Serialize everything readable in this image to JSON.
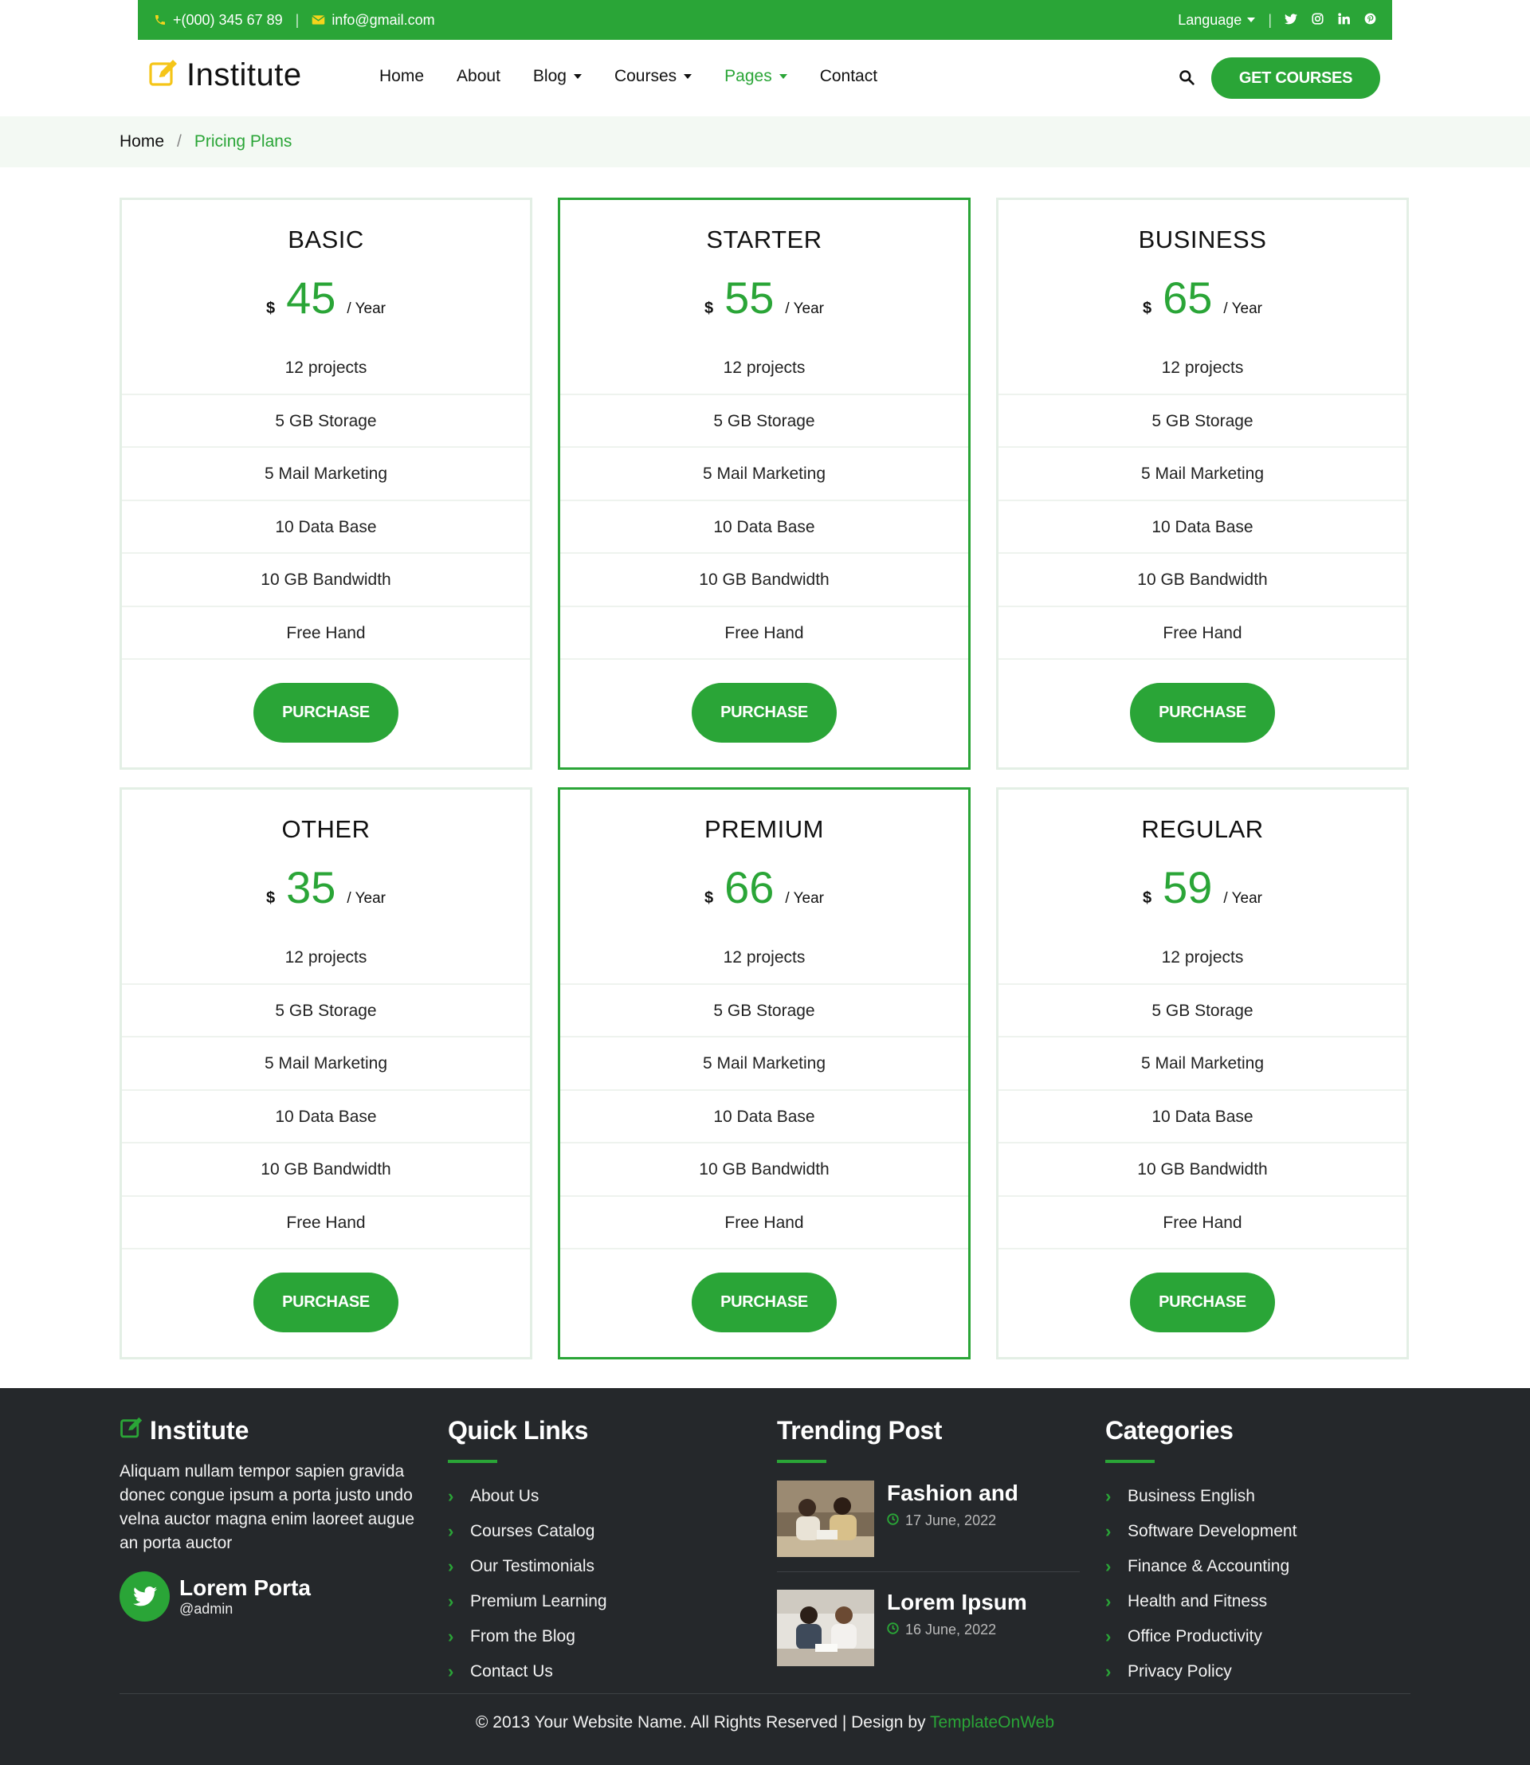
{
  "topbar": {
    "phone": "+(000) 345 67 89",
    "email": "info@gmail.com",
    "language_label": "Language",
    "socials": [
      "twitter-icon",
      "instagram-icon",
      "linkedin-icon",
      "pinterest-icon"
    ]
  },
  "header": {
    "logo_text": "Institute",
    "nav": [
      {
        "label": "Home",
        "dropdown": false,
        "active": false
      },
      {
        "label": "About",
        "dropdown": false,
        "active": false
      },
      {
        "label": "Blog",
        "dropdown": true,
        "active": false
      },
      {
        "label": "Courses",
        "dropdown": true,
        "active": false
      },
      {
        "label": "Pages",
        "dropdown": true,
        "active": true
      },
      {
        "label": "Contact",
        "dropdown": false,
        "active": false
      }
    ],
    "cta_label": "GET COURSES"
  },
  "breadcrumb": {
    "home": "Home",
    "separator": "/",
    "current": "Pricing Plans"
  },
  "pricing": {
    "plans": [
      {
        "name": "BASIC",
        "currency": "$",
        "amount": "45",
        "period": "/ Year",
        "featured": false,
        "features": [
          "12 projects",
          "5 GB Storage",
          "5 Mail Marketing",
          "10 Data Base",
          "10 GB Bandwidth",
          "Free Hand"
        ],
        "button": "PURCHASE"
      },
      {
        "name": "STARTER",
        "currency": "$",
        "amount": "55",
        "period": "/ Year",
        "featured": true,
        "features": [
          "12 projects",
          "5 GB Storage",
          "5 Mail Marketing",
          "10 Data Base",
          "10 GB Bandwidth",
          "Free Hand"
        ],
        "button": "PURCHASE"
      },
      {
        "name": "BUSINESS",
        "currency": "$",
        "amount": "65",
        "period": "/ Year",
        "featured": false,
        "features": [
          "12 projects",
          "5 GB Storage",
          "5 Mail Marketing",
          "10 Data Base",
          "10 GB Bandwidth",
          "Free Hand"
        ],
        "button": "PURCHASE"
      },
      {
        "name": "OTHER",
        "currency": "$",
        "amount": "35",
        "period": "/ Year",
        "featured": false,
        "features": [
          "12 projects",
          "5 GB Storage",
          "5 Mail Marketing",
          "10 Data Base",
          "10 GB Bandwidth",
          "Free Hand"
        ],
        "button": "PURCHASE"
      },
      {
        "name": "PREMIUM",
        "currency": "$",
        "amount": "66",
        "period": "/ Year",
        "featured": true,
        "features": [
          "12 projects",
          "5 GB Storage",
          "5 Mail Marketing",
          "10 Data Base",
          "10 GB Bandwidth",
          "Free Hand"
        ],
        "button": "PURCHASE"
      },
      {
        "name": "REGULAR",
        "currency": "$",
        "amount": "59",
        "period": "/ Year",
        "featured": false,
        "features": [
          "12 projects",
          "5 GB Storage",
          "5 Mail Marketing",
          "10 Data Base",
          "10 GB Bandwidth",
          "Free Hand"
        ],
        "button": "PURCHASE"
      }
    ]
  },
  "footer": {
    "about": {
      "logo_text": "Institute",
      "text": "Aliquam nullam tempor sapien gravida donec congue ipsum a porta justo undo velna auctor magna enim laoreet augue an porta auctor",
      "twitter_name": "Lorem Porta",
      "twitter_handle": "@admin"
    },
    "quick_links": {
      "title": "Quick Links",
      "items": [
        "About Us",
        "Courses Catalog",
        "Our Testimonials",
        "Premium Learning",
        "From the Blog",
        "Contact Us"
      ]
    },
    "trending": {
      "title": "Trending Post",
      "posts": [
        {
          "title": "Fashion and",
          "date": "17 June, 2022"
        },
        {
          "title": "Lorem Ipsum",
          "date": "16 June, 2022"
        }
      ]
    },
    "categories": {
      "title": "Categories",
      "items": [
        "Business English",
        "Software Development",
        "Finance & Accounting",
        "Health and Fitness",
        "Office Productivity",
        "Privacy Policy"
      ]
    },
    "copyright_prefix": "© 2013 Your Website Name. All Rights Reserved | Design by",
    "copyright_link": "TemplateOnWeb"
  },
  "colors": {
    "brand_green": "#2aa537",
    "accent_yellow": "#f5d41c",
    "footer_bg": "#25282b",
    "breadcrumb_bg": "#f3f9f3"
  }
}
